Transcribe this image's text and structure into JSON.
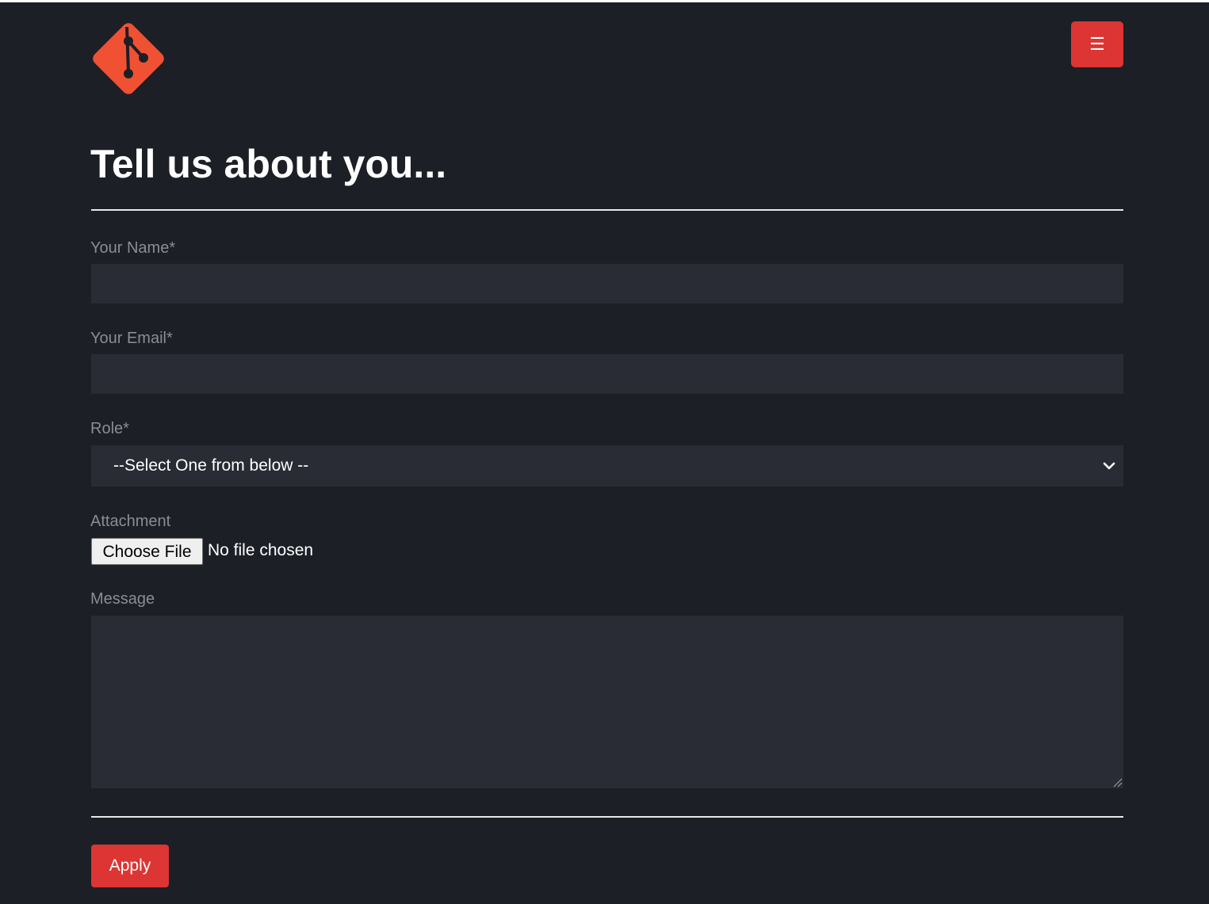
{
  "header": {
    "logo_icon": "git-logo-icon",
    "menu_icon": "☰",
    "accent_color": "#dc3533",
    "logo_color": "#f05133"
  },
  "form": {
    "title": "Tell us about you...",
    "name": {
      "label": "Your Name*",
      "value": "",
      "placeholder": ""
    },
    "email": {
      "label": "Your Email*",
      "value": "",
      "placeholder": ""
    },
    "role": {
      "label": "Role*",
      "selected": "--Select One from below --"
    },
    "attachment": {
      "label": "Attachment",
      "button": "Choose File",
      "status": "No file chosen"
    },
    "message": {
      "label": "Message",
      "value": ""
    },
    "submit_label": "Apply"
  },
  "colors": {
    "background": "#1d1f26",
    "field_background": "#292c35",
    "label": "#8b8d92"
  }
}
